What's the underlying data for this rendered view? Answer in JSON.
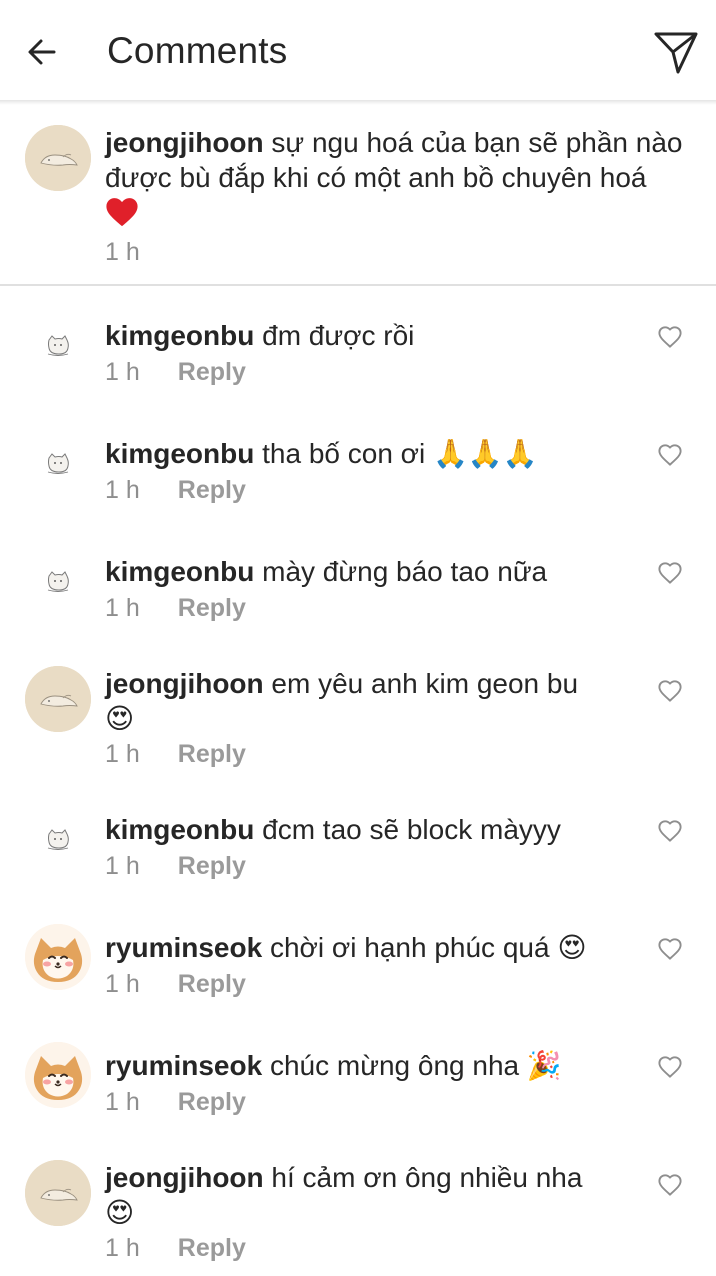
{
  "header": {
    "title": "Comments",
    "back_icon": "arrow-left-icon",
    "send_icon": "paper-plane-icon"
  },
  "caption": {
    "username": "jeongjihoon",
    "text": "sự ngu hoá của bạn sẽ phần nào được bù đắp khi có một anh bồ chuyên hoá",
    "emoji": "❤️",
    "time": "1 h"
  },
  "reply_label": "Reply",
  "comments": [
    {
      "username": "kimgeonbu",
      "text": "đm được rồi",
      "emoji": "",
      "time": "1 h"
    },
    {
      "username": "kimgeonbu",
      "text": "tha bố con ơi",
      "emoji": "🙏🙏🙏",
      "time": "1 h"
    },
    {
      "username": "kimgeonbu",
      "text": "mày đừng báo tao nữa",
      "emoji": "",
      "time": "1 h"
    },
    {
      "username": "jeongjihoon",
      "text": "em yêu anh kim geon bu",
      "emoji": "😍",
      "time": "1 h"
    },
    {
      "username": "kimgeonbu",
      "text": "đcm tao sẽ block màyyy",
      "emoji": "",
      "time": "1 h"
    },
    {
      "username": "ryuminseok",
      "text": "chời ơi hạnh phúc quá",
      "emoji": "😍",
      "time": "1 h"
    },
    {
      "username": "ryuminseok",
      "text": "chúc mừng ông nha",
      "emoji": "🎉",
      "time": "1 h"
    },
    {
      "username": "jeongjihoon",
      "text": "hí cảm ơn ông nhiều nha",
      "emoji": "😍",
      "time": "1 h"
    }
  ],
  "colors": {
    "text": "#262626",
    "meta": "#8e8e8e",
    "divider": "#e0e0e0"
  }
}
